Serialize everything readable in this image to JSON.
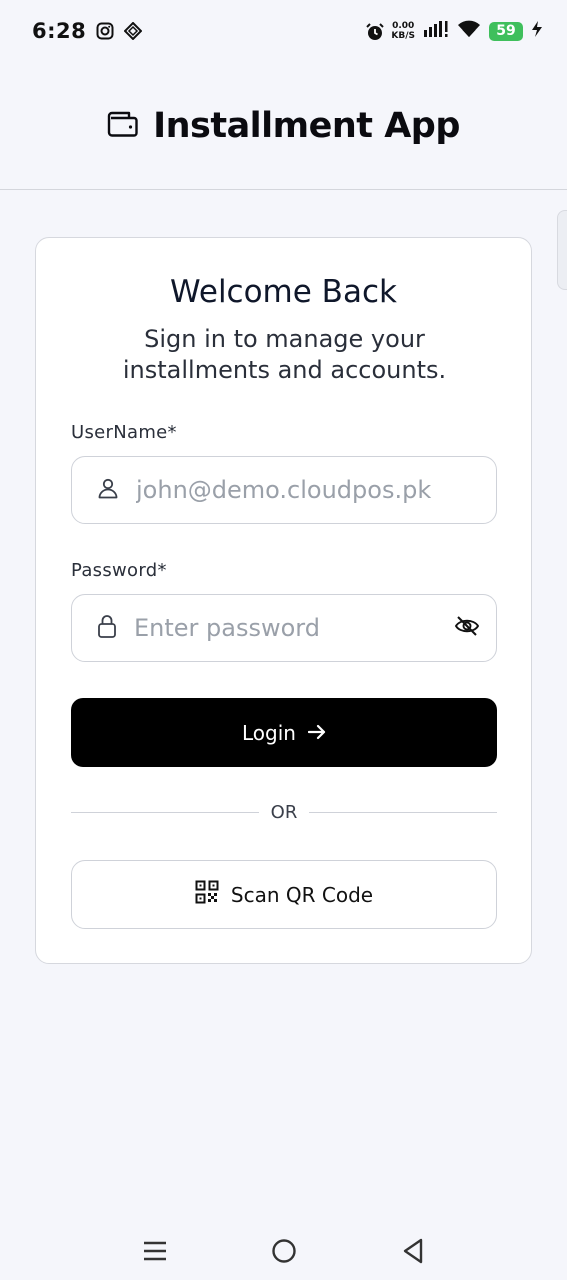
{
  "status_bar": {
    "time": "6:28",
    "net_speed_value": "0.00",
    "net_speed_unit": "KB/S",
    "battery": "59"
  },
  "header": {
    "title": "Installment App",
    "icon": "wallet-icon"
  },
  "card": {
    "title": "Welcome Back",
    "subtitle": "Sign in to manage your installments and accounts.",
    "username": {
      "label": "UserName*",
      "value": "",
      "placeholder": "john@demo.cloudpos.pk",
      "icon": "user-icon"
    },
    "password": {
      "label": "Password*",
      "value": "",
      "placeholder": "Enter password",
      "icon": "lock-icon",
      "toggle_icon": "eye-off-icon"
    },
    "login_button": {
      "label": "Login",
      "icon": "arrow-right-icon"
    },
    "divider_text": "OR",
    "qr_button": {
      "label": "Scan QR Code",
      "icon": "qr-code-icon"
    }
  },
  "colors": {
    "background": "#f5f6fb",
    "primary_button": "#000000",
    "battery": "#3fbf5c"
  }
}
